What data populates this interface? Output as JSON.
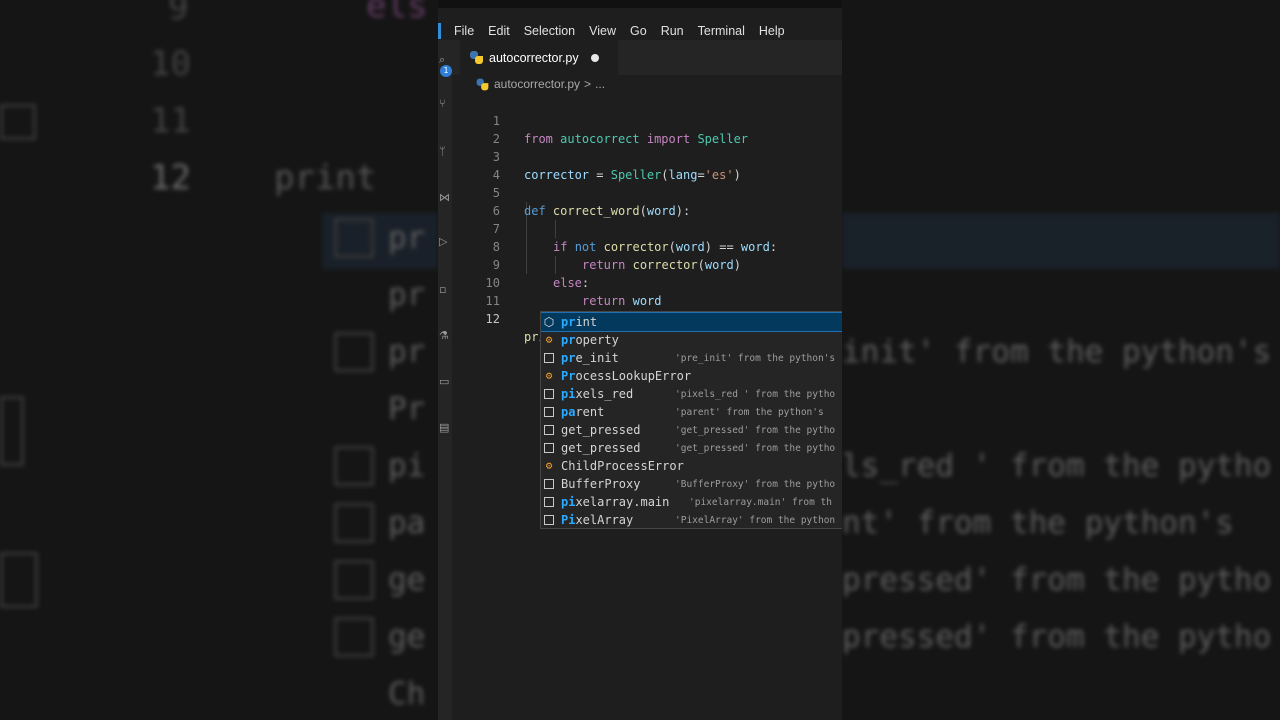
{
  "background": {
    "line_numbers": [
      "9",
      "10",
      "11",
      "12"
    ],
    "current_line_text": "print",
    "partial_top": "els",
    "right_details": [
      "init' from the python's",
      "ls_red ' from the pytho",
      "nt' from the python's",
      "pressed' from the pytho",
      "pressed' from the pytho"
    ],
    "left_items": [
      "pr",
      "pr",
      "pr",
      "Pr",
      "pi",
      "pa",
      "ge",
      "ge",
      "Ch"
    ]
  },
  "menu": [
    "File",
    "Edit",
    "Selection",
    "View",
    "Go",
    "Run",
    "Terminal",
    "Help"
  ],
  "tab": {
    "label": "autocorrector.py",
    "modified": true
  },
  "breadcrumb": {
    "file": "autocorrector.py",
    "sep": ">",
    "rest": "..."
  },
  "activity_badge": "1",
  "code_lines": [
    {
      "n": "1"
    },
    {
      "n": "2"
    },
    {
      "n": "3"
    },
    {
      "n": "4"
    },
    {
      "n": "5"
    },
    {
      "n": "6"
    },
    {
      "n": "7"
    },
    {
      "n": "8"
    },
    {
      "n": "9"
    },
    {
      "n": "10"
    },
    {
      "n": "11"
    },
    {
      "n": "12"
    }
  ],
  "code": {
    "l1": {
      "from": "from",
      "mod": "autocorrect",
      "import": "import",
      "cls": "Speller"
    },
    "l3": {
      "var": "corrector",
      "eq": " = ",
      "cls": "Speller",
      "open": "(",
      "arg": "lang",
      "eq2": "=",
      "str": "'es'",
      "close": ")"
    },
    "l5": {
      "def": "def",
      "fn": "correct_word",
      "open": "(",
      "param": "word",
      "close": "):"
    },
    "l7": {
      "if": "if",
      "not": "not",
      "fn": "corrector",
      "open": "(",
      "arg": "word",
      "close": ")",
      "op": " == ",
      "var": "word",
      "colon": ":"
    },
    "l8": {
      "ret": "return",
      "fn": "corrector",
      "open": "(",
      "arg": "word",
      "close": ")"
    },
    "l9": {
      "else": "else",
      "colon": ":"
    },
    "l10": {
      "ret": "return",
      "var": "word"
    },
    "l12": {
      "text": "print"
    }
  },
  "suggestions": [
    {
      "icon": "method",
      "hl": "pr",
      "rest": "int",
      "detail": ""
    },
    {
      "icon": "class",
      "hl": "pr",
      "rest": "operty",
      "detail": ""
    },
    {
      "icon": "box",
      "hl": "pr",
      "rest": "e_init",
      "detail": "'pre_init' from the python's"
    },
    {
      "icon": "class",
      "hl": "Pr",
      "rest": "ocessLookupError",
      "detail": ""
    },
    {
      "icon": "box",
      "hl": "pi",
      "rest": "xels_red",
      "detail": "'pixels_red ' from the pytho"
    },
    {
      "icon": "box",
      "hl": "pa",
      "rest": "rent",
      "detail": "'parent' from the python's"
    },
    {
      "icon": "box",
      "hl": "get_pr",
      "rest": "essed",
      "detail": "'get_pressed' from the pytho"
    },
    {
      "icon": "box",
      "hl": "get_pr",
      "rest": "essed",
      "detail": "'get_pressed' from the pytho"
    },
    {
      "icon": "class",
      "hl": "ChildPr",
      "rest": "ocessError",
      "detail": ""
    },
    {
      "icon": "box",
      "hl": "BufferPr",
      "rest": "oxy",
      "detail": "'BufferProxy' from the pytho"
    },
    {
      "icon": "box",
      "hl": "pi",
      "rest": "xelarray.main",
      "detail": "'pixelarray.main' from th"
    },
    {
      "icon": "box",
      "hl": "Pi",
      "rest": "xelArray",
      "detail": "'PixelArray' from the python"
    }
  ]
}
